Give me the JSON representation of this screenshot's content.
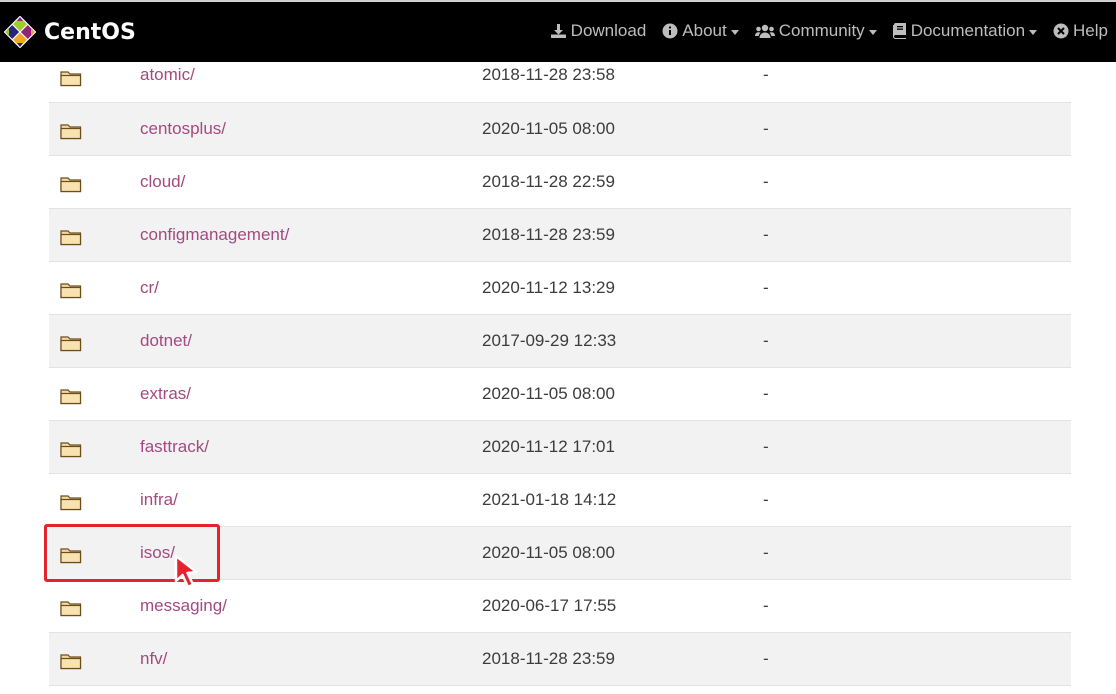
{
  "navbar": {
    "brand": "CentOS",
    "items": [
      {
        "label": "Download",
        "icon": "download-icon",
        "dropdown": false
      },
      {
        "label": "About",
        "icon": "info-circle-icon",
        "dropdown": true
      },
      {
        "label": "Community",
        "icon": "users-icon",
        "dropdown": true
      },
      {
        "label": "Documentation",
        "icon": "book-icon",
        "dropdown": true
      },
      {
        "label": "Help",
        "icon": "close-circle-icon",
        "dropdown": false
      }
    ]
  },
  "listing": {
    "rows": [
      {
        "name": "atomic/",
        "date": "2018-11-28 23:58",
        "size": "-"
      },
      {
        "name": "centosplus/",
        "date": "2020-11-05 08:00",
        "size": "-"
      },
      {
        "name": "cloud/",
        "date": "2018-11-28 22:59",
        "size": "-"
      },
      {
        "name": "configmanagement/",
        "date": "2018-11-28 23:59",
        "size": "-"
      },
      {
        "name": "cr/",
        "date": "2020-11-12 13:29",
        "size": "-"
      },
      {
        "name": "dotnet/",
        "date": "2017-09-29 12:33",
        "size": "-"
      },
      {
        "name": "extras/",
        "date": "2020-11-05 08:00",
        "size": "-"
      },
      {
        "name": "fasttrack/",
        "date": "2020-11-12 17:01",
        "size": "-"
      },
      {
        "name": "infra/",
        "date": "2021-01-18 14:12",
        "size": "-"
      },
      {
        "name": "isos/",
        "date": "2020-11-05 08:00",
        "size": "-"
      },
      {
        "name": "messaging/",
        "date": "2020-06-17 17:55",
        "size": "-"
      },
      {
        "name": "nfv/",
        "date": "2018-11-28 23:59",
        "size": "-"
      }
    ]
  },
  "colors": {
    "navbar_bg": "#000000",
    "nav_text": "#bdbdbd",
    "link": "#a44a80",
    "highlight": "#e8212f",
    "row_stripe": "#f2f2f2"
  }
}
